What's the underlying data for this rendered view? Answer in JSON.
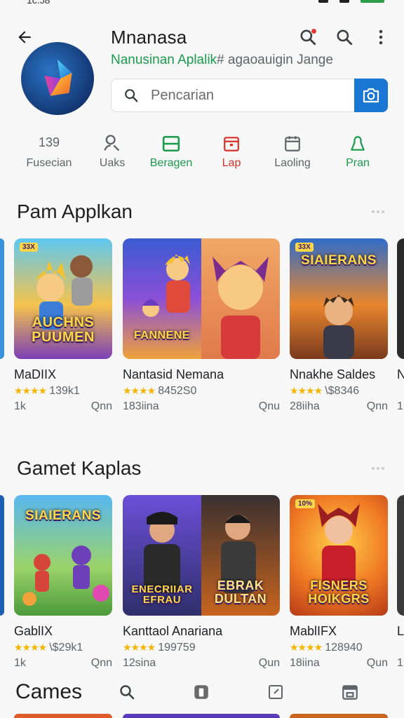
{
  "status": {
    "time": "1c.ɔ8"
  },
  "header": {
    "title": "Mnanasa",
    "subtitle_green": "Nanusinan Aplalik",
    "subtitle_rest": "# agaoauigin Jange"
  },
  "search": {
    "placeholder": "Pencarian"
  },
  "categories": [
    {
      "top": "139",
      "label": "Fusecian"
    },
    {
      "top": "",
      "label": "Uaks"
    },
    {
      "top": "",
      "label": "Beragen"
    },
    {
      "top": "",
      "label": "Lap"
    },
    {
      "top": "",
      "label": "Laoling"
    },
    {
      "top": "",
      "label": "Pran"
    }
  ],
  "colors": {
    "accent": "#1976d2",
    "green": "#1a9a4a",
    "red": "#d93025",
    "star": "#f4b400"
  },
  "section1": {
    "title": "Pam Applkan",
    "cards": [
      {
        "name": "MaDIIX",
        "rating": "139k1",
        "meta_left": "1k",
        "meta_right": "Qnn",
        "art": "AUCHNS PUUMEN",
        "badge": "33X"
      },
      {
        "name": "Nantasid Nemana",
        "rating": "8452S0",
        "meta_left": "183iina",
        "meta_right": "Qnu",
        "art": "FANNENE"
      },
      {
        "name": "Nnakhe Saldes",
        "rating": "\\$8346",
        "meta_left": "28iiha",
        "meta_right": "Qnn",
        "art": "SIAIERANS",
        "badge": "33X"
      }
    ],
    "peek_name": "N",
    "peek_meta": "1"
  },
  "section2": {
    "title": "Gamet Kaplas",
    "cards": [
      {
        "name": "GablIX",
        "rating": "\\$29k1",
        "meta_left": "1k",
        "meta_right": "Qnn",
        "art": "SIAIERANS"
      },
      {
        "name": "Kanttaol Anariana",
        "rating": "199759",
        "meta_left": "12sina",
        "meta_right": "Qun",
        "art_left": "ENECRIIAR EFRAU",
        "art_right": "EBRAK DULTAN"
      },
      {
        "name": "MablIFX",
        "rating": "128940",
        "meta_left": "18iina",
        "meta_right": "Qun",
        "art": "FISNERS HOIKGRS",
        "badge": "10%"
      }
    ],
    "peek_name": "L",
    "peek_meta": "1"
  },
  "bottom": {
    "title": "Cames"
  }
}
